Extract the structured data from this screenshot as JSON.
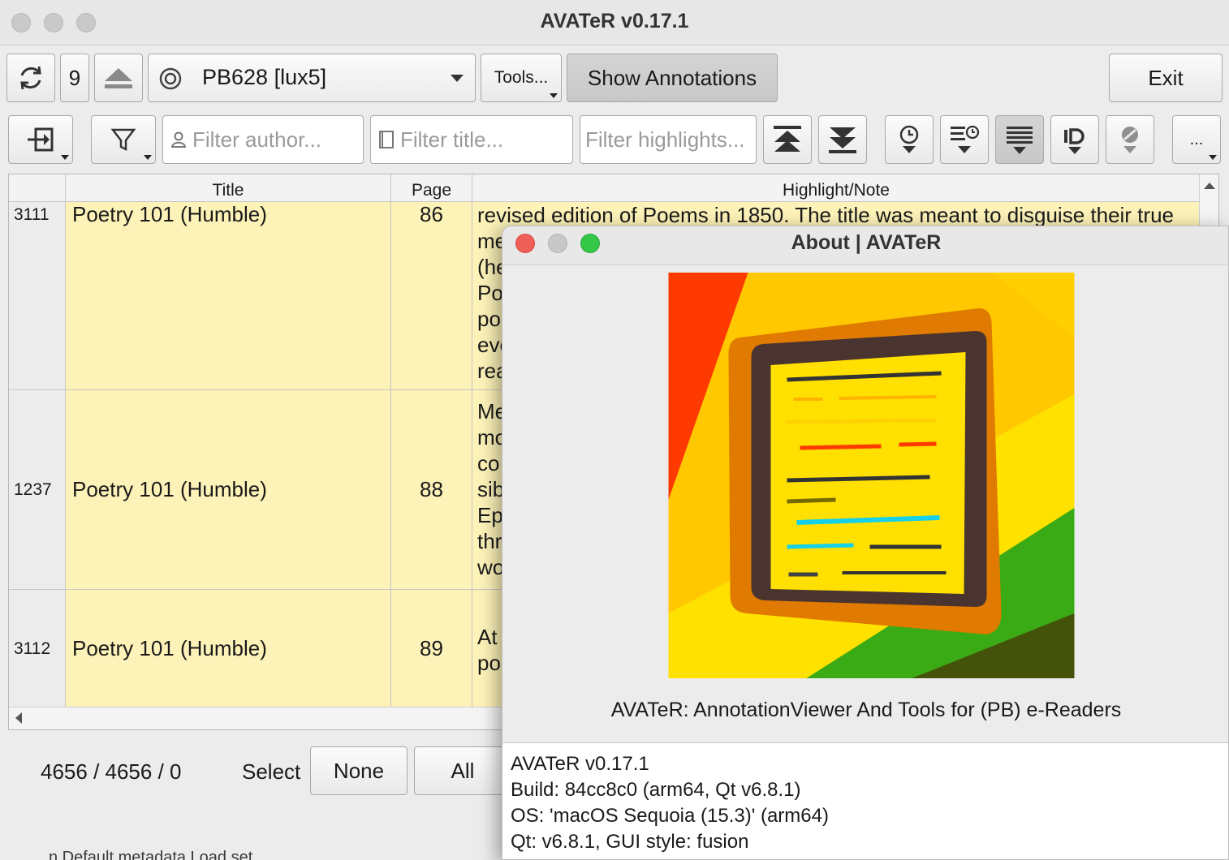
{
  "window": {
    "title": "AVATeR v0.17.1"
  },
  "toolbar": {
    "device_count": "9",
    "device_name": "PB628 [lux5]",
    "tools_label": "Tools...",
    "show_annotations_label": "Show Annotations",
    "exit_label": "Exit"
  },
  "filters": {
    "author_placeholder": "Filter author...",
    "title_placeholder": "Filter title...",
    "highlights_placeholder": "Filter highlights...",
    "more_label": "..."
  },
  "table": {
    "columns": [
      "Title",
      "Page",
      "Highlight/Note"
    ],
    "rows": [
      {
        "id": "3111",
        "title": "Poetry 101 (Humble)",
        "page": "86",
        "note_lines": [
          "revised edition of Poems in 1850. The title was meant to disguise their true",
          "me",
          "(he",
          "Po",
          "po",
          "eve",
          "rea"
        ]
      },
      {
        "id": "1237",
        "title": "Poetry 101 (Humble)",
        "page": "88",
        "note_lines": [
          "Me",
          "mo",
          "co",
          "sib",
          "Ep",
          "thr",
          "wo"
        ]
      },
      {
        "id": "3112",
        "title": "Poetry 101 (Humble)",
        "page": "89",
        "note_lines": [
          "At",
          "po"
        ]
      }
    ]
  },
  "bottom": {
    "counts": "4656 / 4656 / 0",
    "select_label": "Select",
    "none_label": "None",
    "all_label": "All",
    "background_peek": "n Default metadata    Load set"
  },
  "about": {
    "title": "About | AVATeR",
    "caption": "AVATeR: AnnotationViewer And Tools for (PB) e-Readers",
    "info_lines": [
      "AVATeR v0.17.1",
      "Build: 84cc8c0 (arm64, Qt v6.8.1)",
      "OS: 'macOS Sequoia (15.3)' (arm64)",
      "Qt: v6.8.1, GUI style: fusion"
    ]
  },
  "colors": {
    "highlight_row": "#fdf2b8",
    "mac_close": "#ee5f57",
    "mac_minimize": "#c8c8c8",
    "mac_zoom": "#35c748"
  }
}
